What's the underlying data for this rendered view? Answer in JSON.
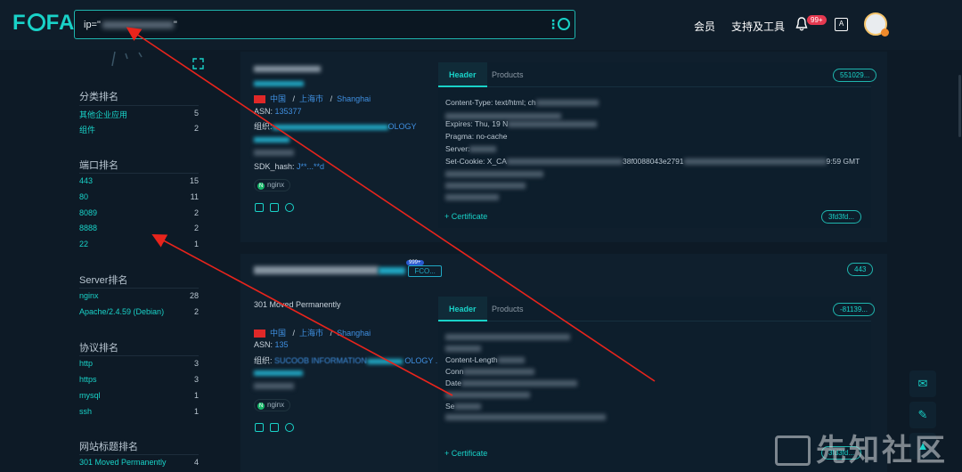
{
  "brand": {
    "logo_text_left": "F",
    "logo_text_right": "FA"
  },
  "search": {
    "query": "ip=\"",
    "query_end": "\""
  },
  "nav": {
    "vip": "会员",
    "support": "支持及工具",
    "bell_badge": "99+"
  },
  "sidebar": {
    "categories_title": "分类排名",
    "categories": [
      {
        "label": "其他企业应用",
        "count": "5"
      },
      {
        "label": "组件",
        "count": "2"
      }
    ],
    "ports_title": "端口排名",
    "ports": [
      {
        "label": "443",
        "count": "15"
      },
      {
        "label": "80",
        "count": "11"
      },
      {
        "label": "8089",
        "count": "2"
      },
      {
        "label": "8888",
        "count": "2"
      },
      {
        "label": "22",
        "count": "1"
      }
    ],
    "servers_title": "Server排名",
    "servers": [
      {
        "label": "nginx",
        "count": "28"
      },
      {
        "label": "Apache/2.4.59 (Debian)",
        "count": "2"
      }
    ],
    "protocols_title": "协议排名",
    "protocols": [
      {
        "label": "http",
        "count": "3"
      },
      {
        "label": "https",
        "count": "3"
      },
      {
        "label": "mysql",
        "count": "1"
      },
      {
        "label": "ssh",
        "count": "1"
      }
    ],
    "titles_title": "网站标题排名",
    "titles": [
      {
        "label": "301 Moved Permanently",
        "count": "4"
      }
    ]
  },
  "card1": {
    "country": "中国",
    "region": "上海市",
    "city": "Shanghai",
    "sep": "/",
    "asn_label": "ASN:",
    "asn_value": "135377",
    "org_label": "组织:",
    "org_tail": "OLOGY",
    "sdk_label": "SDK_hash:",
    "sdk_value": "J**...**d",
    "tag": "nginx",
    "tab_header": "Header",
    "tab_products": "Products",
    "pill": "551029...",
    "headers": [
      "Content-Type: text/html; ch",
      "Expires: Thu, 19 N",
      "Pragma: no-cache",
      "Server:",
      "Set-Cookie: X_CA",
      "38f0088043e2791",
      "9:59 GMT"
    ],
    "cert_label": "+ Certificate",
    "cert_pill": "3fd3fd..."
  },
  "card2": {
    "title_suffix": "FCO...",
    "mini_badge": "999+",
    "port_pill": "443",
    "status": "301 Moved Permanently",
    "country": "中国",
    "region": "上海市",
    "city": "Shanghai",
    "sep": "/",
    "asn_label": "ASN:",
    "asn_value": "135",
    "org_label": "组织:",
    "org_value": "SUCOOB INFORMATION",
    "org_tail": "OLOGY ...",
    "tag": "nginx",
    "tab_header": "Header",
    "tab_products": "Products",
    "pill": "-81139...",
    "headers": [
      "Content-Length",
      "Conn",
      "Date",
      "Se"
    ],
    "cert_label": "+ Certificate",
    "cert_pill": "3fd3fd..."
  },
  "watermark": "先知社区",
  "colors": {
    "accent": "#19d2c8",
    "link": "#3f8fe0",
    "arrow": "#e8241c",
    "badge": "#e53950"
  }
}
